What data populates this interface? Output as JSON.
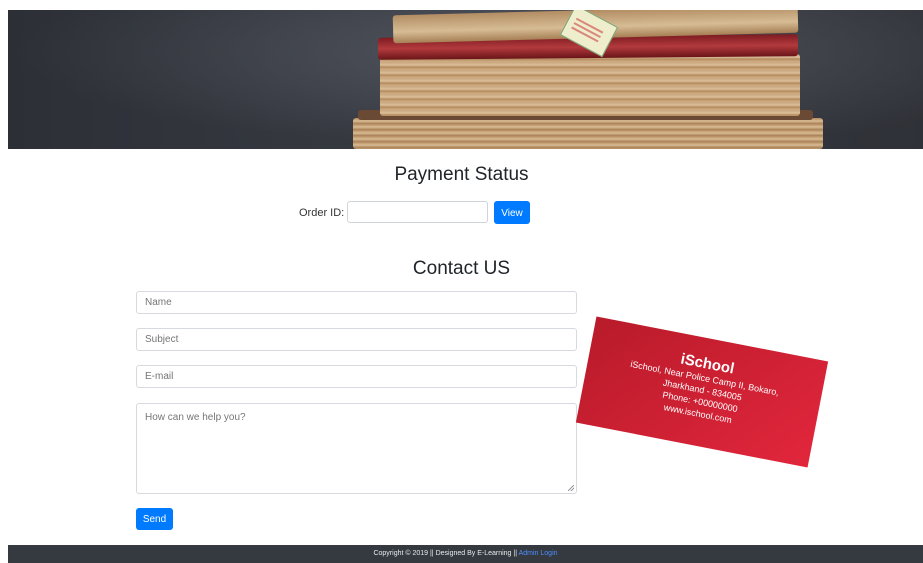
{
  "payment": {
    "title": "Payment Status",
    "order_label": "Order ID:",
    "order_value": "",
    "view_label": "View"
  },
  "contact": {
    "title": "Contact US",
    "name_placeholder": "Name",
    "subject_placeholder": "Subject",
    "email_placeholder": "E-mail",
    "message_placeholder": "How can we help you?",
    "send_label": "Send"
  },
  "card": {
    "title": "iSchool",
    "lines": [
      "iSchool, Near Police Camp II, Bokaro,",
      "Jharkhand - 834005",
      "Phone: +00000000",
      "www.ischool.com"
    ]
  },
  "footer": {
    "copyright": "Copyright © 2019 || Designed By E-Learning ||",
    "admin_link": "Admin Login"
  },
  "colors": {
    "primary": "#007bff",
    "card_red": "#d3213a",
    "footer_bg": "#343a40"
  }
}
